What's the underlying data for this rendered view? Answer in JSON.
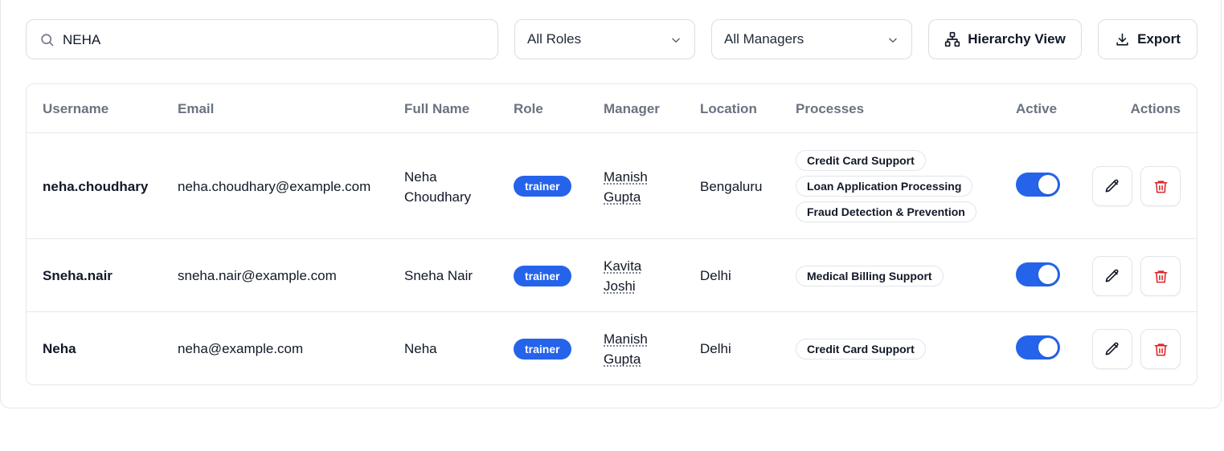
{
  "filters": {
    "search_value": "NEHA",
    "role_select": "All Roles",
    "manager_select": "All Managers",
    "hierarchy_label": "Hierarchy View",
    "export_label": "Export"
  },
  "table": {
    "headers": {
      "username": "Username",
      "email": "Email",
      "full_name": "Full Name",
      "role": "Role",
      "manager": "Manager",
      "location": "Location",
      "processes": "Processes",
      "active": "Active",
      "actions": "Actions"
    },
    "rows": [
      {
        "username": "neha.choudhary",
        "email": "neha.choudhary@example.com",
        "full_name_1": "Neha",
        "full_name_2": "Choudhary",
        "role": "trainer",
        "manager_1": "Manish",
        "manager_2": "Gupta",
        "location": "Bengaluru",
        "processes": [
          "Credit Card Support",
          "Loan Application Processing",
          "Fraud Detection & Prevention"
        ],
        "active": true
      },
      {
        "username": "Sneha.nair",
        "email": "sneha.nair@example.com",
        "full_name_1": "Sneha Nair",
        "role": "trainer",
        "manager_1": "Kavita",
        "manager_2": "Joshi",
        "location": "Delhi",
        "processes": [
          "Medical Billing Support"
        ],
        "active": true
      },
      {
        "username": "Neha",
        "email": "neha@example.com",
        "full_name_1": "Neha",
        "role": "trainer",
        "manager_1": "Manish",
        "manager_2": "Gupta",
        "location": "Delhi",
        "processes": [
          "Credit Card Support"
        ],
        "active": true
      }
    ]
  },
  "icons": {
    "search": "search-icon",
    "chevron": "chevron-down-icon",
    "hierarchy": "hierarchy-icon",
    "export": "download-icon",
    "edit": "pencil-icon",
    "delete": "trash-icon"
  },
  "colors": {
    "accent": "#2563eb",
    "danger": "#dc2626",
    "muted": "#6b7280",
    "border": "#e5e7eb"
  }
}
